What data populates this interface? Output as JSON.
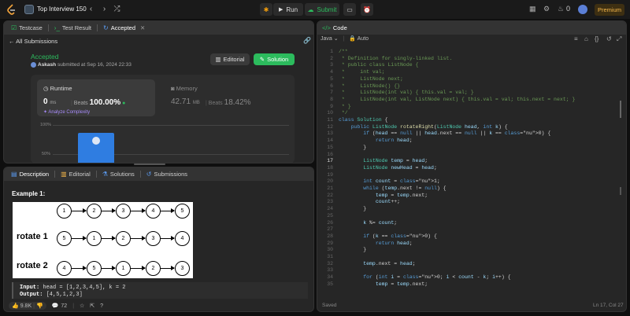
{
  "topbar": {
    "problem_list": "Top Interview 150",
    "run": "Run",
    "submit": "Submit",
    "streak": "0",
    "premium": "Premium"
  },
  "left_top": {
    "tabs": [
      {
        "label": "Testcase"
      },
      {
        "label": "Test Result"
      },
      {
        "label": "Accepted"
      }
    ],
    "all_submissions": "All Submissions",
    "status": "Accepted",
    "user": "Askash",
    "submitted_at": "submitted at Sep 16, 2024 22:33",
    "editorial": "Editorial",
    "solution": "Solution",
    "runtime": {
      "label": "Runtime",
      "value": "0",
      "unit": "ms",
      "beats_label": "Beats",
      "beats_value": "100.00%",
      "analyze": "Analyze Complexity"
    },
    "memory": {
      "label": "Memory",
      "value": "42.71",
      "unit": "MB",
      "beats_label": "Beats",
      "beats_value": "18.42%"
    },
    "chart": {
      "y100": "100%",
      "y50": "50%"
    }
  },
  "left_bottom": {
    "tabs": [
      {
        "label": "Description"
      },
      {
        "label": "Editorial"
      },
      {
        "label": "Solutions"
      },
      {
        "label": "Submissions"
      }
    ],
    "example_title": "Example 1:",
    "diagram": {
      "row0": [
        "1",
        "2",
        "3",
        "4",
        "5"
      ],
      "row1_label": "rotate 1",
      "row1": [
        "5",
        "1",
        "2",
        "3",
        "4"
      ],
      "row2_label": "rotate 2",
      "row2": [
        "4",
        "5",
        "1",
        "2",
        "3"
      ]
    },
    "input_label": "Input:",
    "input_value": "head = [1,2,3,4,5], k = 2",
    "output_label": "Output:",
    "output_value": "[4,5,1,2,3]",
    "likes": "9.8K",
    "comments": "72"
  },
  "editor": {
    "title": "Code",
    "language": "Java",
    "mode": "Auto",
    "saved": "Saved",
    "cursor": "Ln 17, Col 27",
    "current_line": 17,
    "lines": [
      "/**",
      " * Definition for singly-linked list.",
      " * public class ListNode {",
      " *     int val;",
      " *     ListNode next;",
      " *     ListNode() {}",
      " *     ListNode(int val) { this.val = val; }",
      " *     ListNode(int val, ListNode next) { this.val = val; this.next = next; }",
      " * }",
      " */",
      "class Solution {",
      "    public ListNode rotateRight(ListNode head, int k) {",
      "        if (head == null || head.next == null || k == 0) {",
      "            return head;",
      "        }",
      "",
      "        ListNode temp = head;",
      "        ListNode newHead = head;",
      "",
      "        int count = 1;",
      "        while (temp.next != null) {",
      "            temp = temp.next;",
      "            count++;",
      "        }",
      "",
      "        k %= count;",
      "",
      "        if (k == 0) {",
      "            return head;",
      "        }",
      "",
      "        temp.next = head;",
      "",
      "        for (int i = 0; i < count - k; i++) {",
      "            temp = temp.next;"
    ]
  }
}
